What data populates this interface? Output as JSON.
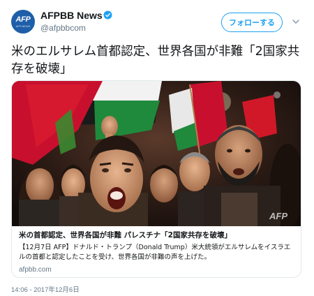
{
  "header": {
    "avatar_text": "AFP",
    "avatar_subtext": "AFP NEWS",
    "account_name": "AFPBB News",
    "handle": "@afpbbcom",
    "follow_label": "フォローする"
  },
  "tweet": {
    "text": "米のエルサレム首都認定、世界各国が非難「2国家共存を破壊」"
  },
  "card": {
    "watermark": "AFP",
    "title": "米の首都認定、世界各国が非難 パレスチナ「2国家共存を破壊」",
    "description": "【12月7日 AFP】ドナルド・トランプ（Donald Trump）米大統領がエルサレムをイスラエルの首都と認定したことを受け、世界各国が非難の声を上げた。",
    "domain": "afpbb.com"
  },
  "timestamp": "14:06 - 2017年12月6日",
  "colors": {
    "accent": "#1da1f2",
    "secondary_text": "#657786",
    "border": "#e1e8ed",
    "avatar_bg": "#1f5ea8"
  }
}
